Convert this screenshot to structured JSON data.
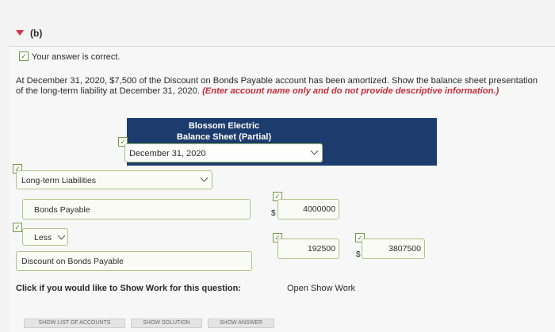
{
  "section": {
    "label": "(b)"
  },
  "feedback": {
    "text": "Your answer is correct."
  },
  "question": {
    "text": "At December 31, 2020, $7,500 of the Discount on Bonds Payable account has been amortized. Show the balance sheet presentation of the long-term liability at December 31, 2020.",
    "instruction": "(Enter account name only and do not provide descriptive information.)"
  },
  "statement": {
    "company": "Blossom Electric",
    "title": "Balance Sheet (Partial)",
    "date": "December 31, 2020"
  },
  "rows": {
    "category": "Long-term Liabilities",
    "bonds_label": "Bonds Payable",
    "bonds_value": "4000000",
    "less_label": "Less",
    "discount_label": "Discount on Bonds Payable",
    "discount_value": "192500",
    "net_value": "3807500",
    "currency": "$"
  },
  "show_work": {
    "prompt": "Click if you would like to Show Work for this question:",
    "link": "Open Show Work"
  },
  "buttons": {
    "accounts": "SHOW LIST OF ACCOUNTS",
    "solution": "SHOW SOLUTION",
    "answer": "SHOW ANSWER"
  },
  "colors": {
    "header_band": "#1d3c6e",
    "instruction_red": "#c72d3a",
    "check_green": "#6f9a43"
  }
}
